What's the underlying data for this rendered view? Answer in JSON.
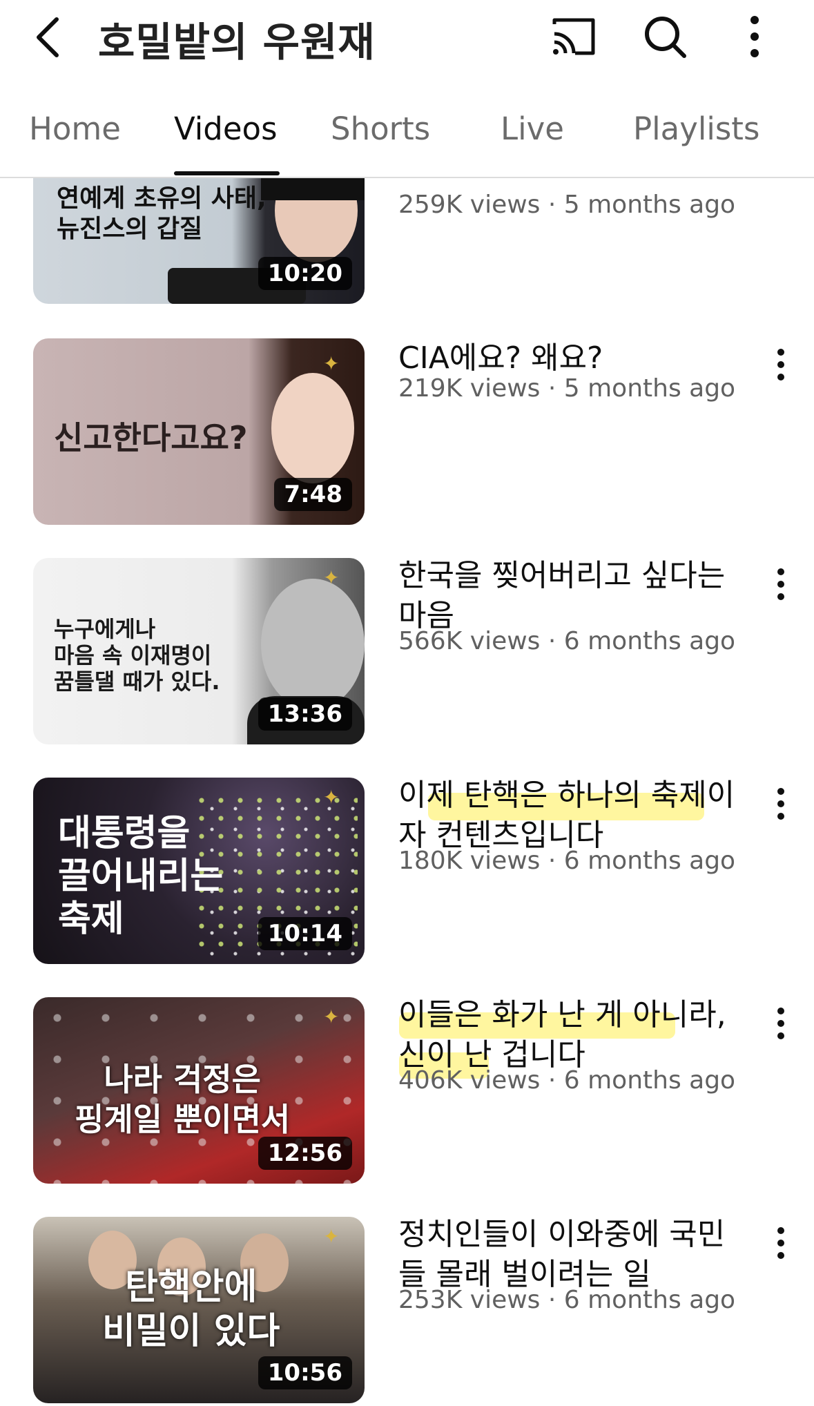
{
  "header": {
    "channel_title": "호밀밭의 우원재",
    "icons": [
      "back-arrow-icon",
      "cast-icon",
      "search-icon",
      "more-vertical-icon"
    ]
  },
  "tabs": [
    {
      "label": "Home",
      "active": false
    },
    {
      "label": "Videos",
      "active": true
    },
    {
      "label": "Shorts",
      "active": false
    },
    {
      "label": "Live",
      "active": false
    },
    {
      "label": "Playlists",
      "active": false
    }
  ],
  "videos": [
    {
      "thumb_text": "연예계 초유의 사태,\n뉴진스의 갑질",
      "duration": "10:20",
      "title": "",
      "meta": "259K views · 5 months ago"
    },
    {
      "thumb_text": "신고한다고요?",
      "duration": "7:48",
      "title": "CIA에요? 왜요?",
      "meta": "219K views · 5 months ago"
    },
    {
      "thumb_text": "누구에게나\n마음 속 이재명이\n꿈틀댈 때가 있다.",
      "duration": "13:36",
      "title": "한국을 찢어버리고 싶다는\n마음",
      "meta": "566K views · 6 months ago"
    },
    {
      "thumb_text": "대통령을\n끌어내리는\n축제",
      "duration": "10:14",
      "title": "이제 탄핵은 하나의 축제이\n자 컨텐츠입니다",
      "meta": "180K views · 6 months ago"
    },
    {
      "thumb_text": "나라 걱정은\n핑계일 뿐이면서",
      "duration": "12:56",
      "title": "이들은 화가 난 게 아니라,\n신이 난 겁니다",
      "meta": "406K views · 6 months ago"
    },
    {
      "thumb_text": "탄핵안에\n비밀이 있다",
      "duration": "10:56",
      "title": "정치인들이 이와중에 국민\n들 몰래 벌이려는 일",
      "meta": "253K views · 6 months ago"
    }
  ],
  "colors": {
    "active_tab": "#0f0f0f",
    "inactive_tab": "#6b6b6b",
    "meta_text": "#606060",
    "highlight": "#ffee50"
  }
}
